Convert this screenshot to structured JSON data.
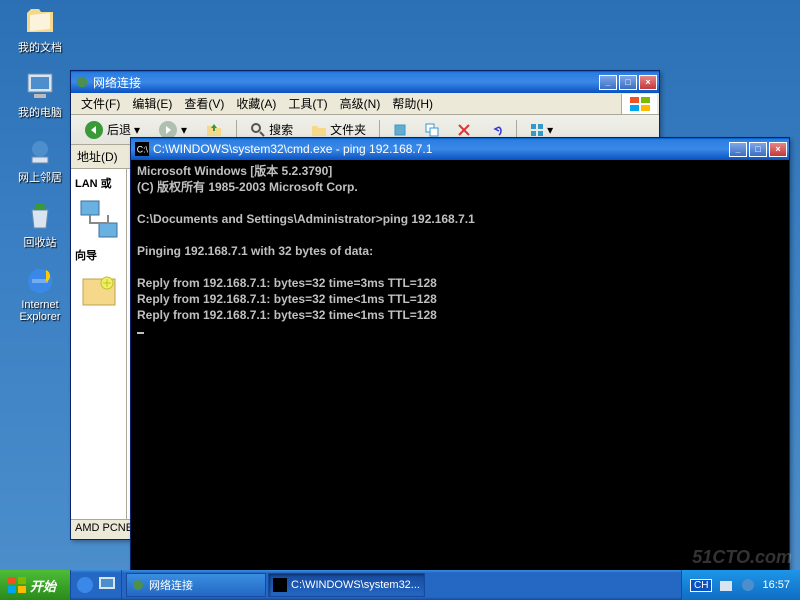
{
  "desktop_icons": [
    {
      "label": "我的文档",
      "key": "my-documents"
    },
    {
      "label": "我的电脑",
      "key": "my-computer"
    },
    {
      "label": "网上邻居",
      "key": "network-places"
    },
    {
      "label": "回收站",
      "key": "recycle-bin"
    },
    {
      "label": "Internet Explorer",
      "key": "ie"
    }
  ],
  "explorer": {
    "title": "网络连接",
    "menu": [
      "文件(F)",
      "编辑(E)",
      "查看(V)",
      "收藏(A)",
      "工具(T)",
      "高级(N)",
      "帮助(H)"
    ],
    "toolbar": {
      "back": "后退",
      "search": "搜索",
      "folders": "文件夹"
    },
    "addr_label": "地址(D)",
    "section1": "LAN 或",
    "section2": "向导",
    "status": "AMD PCNET"
  },
  "cmd": {
    "title": "C:\\WINDOWS\\system32\\cmd.exe - ping 192.168.7.1",
    "lines": [
      "Microsoft Windows [版本 5.2.3790]",
      "(C) 版权所有 1985-2003 Microsoft Corp.",
      "",
      "C:\\Documents and Settings\\Administrator>ping 192.168.7.1",
      "",
      "Pinging 192.168.7.1 with 32 bytes of data:",
      "",
      "Reply from 192.168.7.1: bytes=32 time=3ms TTL=128",
      "Reply from 192.168.7.1: bytes=32 time<1ms TTL=128",
      "Reply from 192.168.7.1: bytes=32 time<1ms TTL=128"
    ]
  },
  "taskbar": {
    "start": "开始",
    "tasks": [
      {
        "label": "网络连接",
        "active": false
      },
      {
        "label": "C:\\WINDOWS\\system32...",
        "active": true
      }
    ],
    "lang": "CH",
    "time": "16:57"
  },
  "watermark": "51CTO.com"
}
